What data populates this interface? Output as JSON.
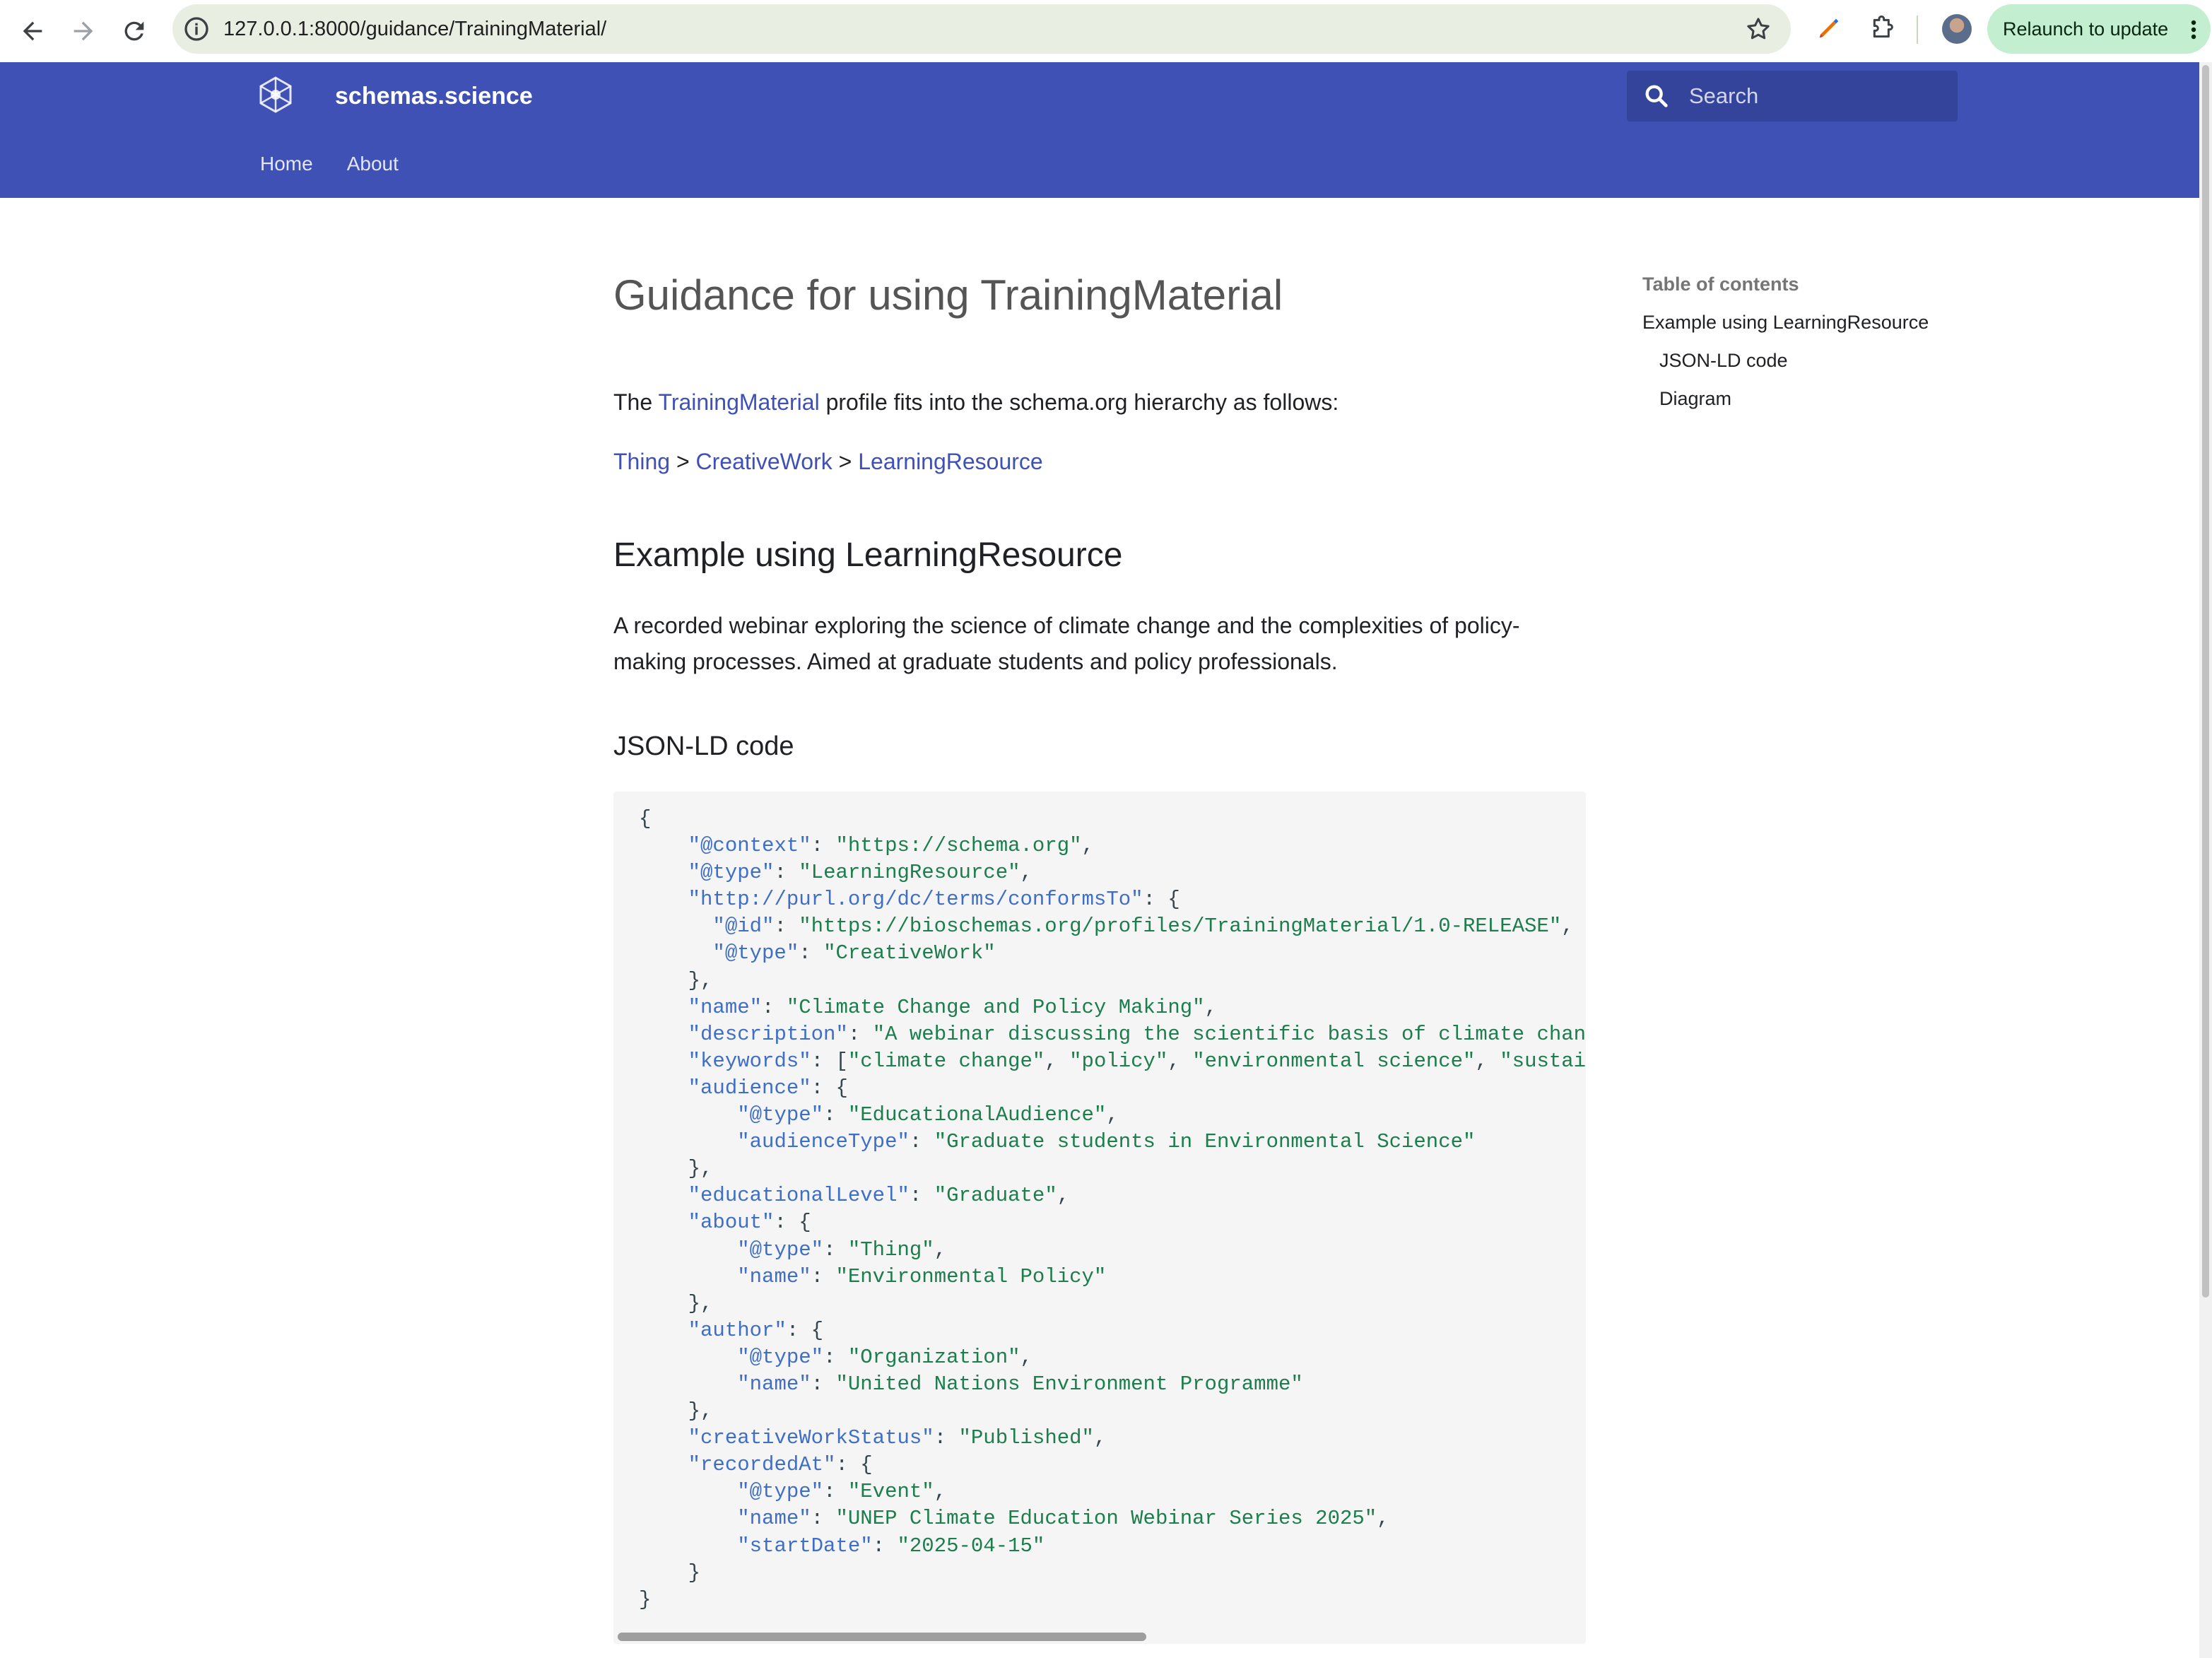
{
  "browser": {
    "url": "127.0.0.1:8000/guidance/TrainingMaterial/",
    "relaunch_label": "Relaunch to update"
  },
  "site": {
    "title": "schemas.science",
    "search_placeholder": "Search",
    "tabs": [
      "Home",
      "About"
    ]
  },
  "page": {
    "title": "Guidance for using TrainingMaterial",
    "intro_prefix": "The",
    "intro_link": "TrainingMaterial",
    "intro_suffix": "profile fits into the schema.org hierarchy as follows:",
    "breadcrumb": [
      "Thing",
      "CreativeWork",
      "LearningResource"
    ],
    "breadcrumb_separator": ">",
    "section_title": "Example using LearningResource",
    "section_description": "A recorded webinar exploring the science of climate change and the complexities of policy-making processes. Aimed at graduate students and policy professionals.",
    "code_heading": "JSON-LD code"
  },
  "code_lines": [
    [
      [
        "p",
        "{"
      ]
    ],
    [
      [
        "p",
        "    "
      ],
      [
        "k",
        "\"@context\""
      ],
      [
        "p",
        ": "
      ],
      [
        "s",
        "\"https://schema.org\""
      ],
      [
        "p",
        ","
      ]
    ],
    [
      [
        "p",
        "    "
      ],
      [
        "k",
        "\"@type\""
      ],
      [
        "p",
        ": "
      ],
      [
        "s",
        "\"LearningResource\""
      ],
      [
        "p",
        ","
      ]
    ],
    [
      [
        "p",
        "    "
      ],
      [
        "k",
        "\"http://purl.org/dc/terms/conformsTo\""
      ],
      [
        "p",
        ": {"
      ]
    ],
    [
      [
        "p",
        "      "
      ],
      [
        "k",
        "\"@id\""
      ],
      [
        "p",
        ": "
      ],
      [
        "s",
        "\"https://bioschemas.org/profiles/TrainingMaterial/1.0-RELEASE\""
      ],
      [
        "p",
        ","
      ]
    ],
    [
      [
        "p",
        "      "
      ],
      [
        "k",
        "\"@type\""
      ],
      [
        "p",
        ": "
      ],
      [
        "s",
        "\"CreativeWork\""
      ]
    ],
    [
      [
        "p",
        "    },"
      ]
    ],
    [
      [
        "p",
        "    "
      ],
      [
        "k",
        "\"name\""
      ],
      [
        "p",
        ": "
      ],
      [
        "s",
        "\"Climate Change and Policy Making\""
      ],
      [
        "p",
        ","
      ]
    ],
    [
      [
        "p",
        "    "
      ],
      [
        "k",
        "\"description\""
      ],
      [
        "p",
        ": "
      ],
      [
        "s",
        "\"A webinar discussing the scientific basis of climate change and"
      ]
    ],
    [
      [
        "p",
        "    "
      ],
      [
        "k",
        "\"keywords\""
      ],
      [
        "p",
        ": ["
      ],
      [
        "s",
        "\"climate change\""
      ],
      [
        "p",
        ", "
      ],
      [
        "s",
        "\"policy\""
      ],
      [
        "p",
        ", "
      ],
      [
        "s",
        "\"environmental science\""
      ],
      [
        "p",
        ", "
      ],
      [
        "s",
        "\"sustainabili"
      ]
    ],
    [
      [
        "p",
        "    "
      ],
      [
        "k",
        "\"audience\""
      ],
      [
        "p",
        ": {"
      ]
    ],
    [
      [
        "p",
        "        "
      ],
      [
        "k",
        "\"@type\""
      ],
      [
        "p",
        ": "
      ],
      [
        "s",
        "\"EducationalAudience\""
      ],
      [
        "p",
        ","
      ]
    ],
    [
      [
        "p",
        "        "
      ],
      [
        "k",
        "\"audienceType\""
      ],
      [
        "p",
        ": "
      ],
      [
        "s",
        "\"Graduate students in Environmental Science\""
      ]
    ],
    [
      [
        "p",
        "    },"
      ]
    ],
    [
      [
        "p",
        "    "
      ],
      [
        "k",
        "\"educationalLevel\""
      ],
      [
        "p",
        ": "
      ],
      [
        "s",
        "\"Graduate\""
      ],
      [
        "p",
        ","
      ]
    ],
    [
      [
        "p",
        "    "
      ],
      [
        "k",
        "\"about\""
      ],
      [
        "p",
        ": {"
      ]
    ],
    [
      [
        "p",
        "        "
      ],
      [
        "k",
        "\"@type\""
      ],
      [
        "p",
        ": "
      ],
      [
        "s",
        "\"Thing\""
      ],
      [
        "p",
        ","
      ]
    ],
    [
      [
        "p",
        "        "
      ],
      [
        "k",
        "\"name\""
      ],
      [
        "p",
        ": "
      ],
      [
        "s",
        "\"Environmental Policy\""
      ]
    ],
    [
      [
        "p",
        "    },"
      ]
    ],
    [
      [
        "p",
        "    "
      ],
      [
        "k",
        "\"author\""
      ],
      [
        "p",
        ": {"
      ]
    ],
    [
      [
        "p",
        "        "
      ],
      [
        "k",
        "\"@type\""
      ],
      [
        "p",
        ": "
      ],
      [
        "s",
        "\"Organization\""
      ],
      [
        "p",
        ","
      ]
    ],
    [
      [
        "p",
        "        "
      ],
      [
        "k",
        "\"name\""
      ],
      [
        "p",
        ": "
      ],
      [
        "s",
        "\"United Nations Environment Programme\""
      ]
    ],
    [
      [
        "p",
        "    },"
      ]
    ],
    [
      [
        "p",
        "    "
      ],
      [
        "k",
        "\"creativeWorkStatus\""
      ],
      [
        "p",
        ": "
      ],
      [
        "s",
        "\"Published\""
      ],
      [
        "p",
        ","
      ]
    ],
    [
      [
        "p",
        "    "
      ],
      [
        "k",
        "\"recordedAt\""
      ],
      [
        "p",
        ": {"
      ]
    ],
    [
      [
        "p",
        "        "
      ],
      [
        "k",
        "\"@type\""
      ],
      [
        "p",
        ": "
      ],
      [
        "s",
        "\"Event\""
      ],
      [
        "p",
        ","
      ]
    ],
    [
      [
        "p",
        "        "
      ],
      [
        "k",
        "\"name\""
      ],
      [
        "p",
        ": "
      ],
      [
        "s",
        "\"UNEP Climate Education Webinar Series 2025\""
      ],
      [
        "p",
        ","
      ]
    ],
    [
      [
        "p",
        "        "
      ],
      [
        "k",
        "\"startDate\""
      ],
      [
        "p",
        ": "
      ],
      [
        "s",
        "\"2025-04-15\""
      ]
    ],
    [
      [
        "p",
        "    }"
      ]
    ],
    [
      [
        "p",
        "}"
      ]
    ]
  ],
  "toc": {
    "title": "Table of contents",
    "items": [
      "Example using LearningResource",
      "JSON-LD code",
      "Diagram"
    ]
  },
  "colors": {
    "header_bg": "#3f51b5",
    "link": "#3f51b5",
    "code_key": "#3f6ec6",
    "code_string": "#1c7d4d"
  },
  "icons": [
    "back-arrow-icon",
    "forward-arrow-icon",
    "reload-icon",
    "site-info-icon",
    "bookmark-star-icon",
    "pen-icon",
    "extensions-puzzle-icon",
    "profile-avatar",
    "menu-dots-icon",
    "site-logo-icon",
    "search-icon"
  ]
}
